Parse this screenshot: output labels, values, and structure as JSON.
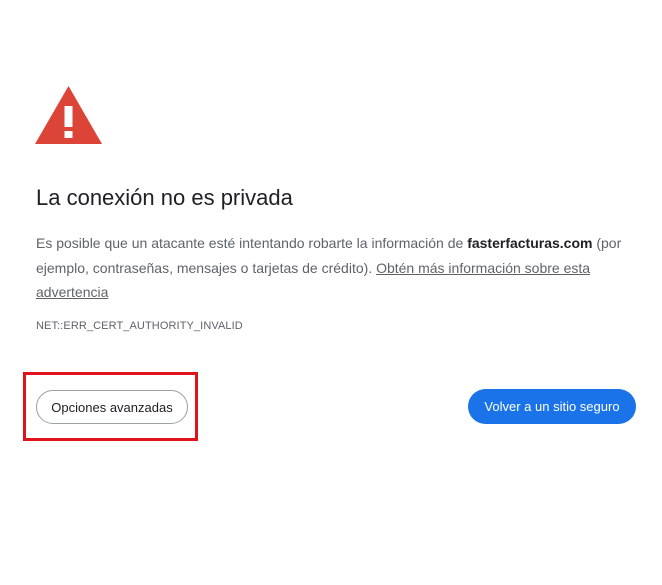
{
  "page": {
    "title": "La conexión no es privada",
    "description_prefix": "Es posible que un atacante esté intentando robarte la información de ",
    "domain": "fasterfacturas.com",
    "description_suffix": " (por ejemplo, contraseñas, mensajes o tarjetas de crédito). ",
    "learn_more_link": "Obtén más información sobre esta advertencia",
    "error_code": "NET::ERR_CERT_AUTHORITY_INVALID"
  },
  "buttons": {
    "advanced_label": "Opciones avanzadas",
    "back_to_safety_label": "Volver a un sitio seguro"
  },
  "icons": {
    "warning": "warning-triangle-icon"
  },
  "colors": {
    "warning_red": "#db4437",
    "primary_blue": "#1a73e8",
    "highlight_red": "#e0121b",
    "text_primary": "#202124",
    "text_secondary": "#5f6368"
  }
}
